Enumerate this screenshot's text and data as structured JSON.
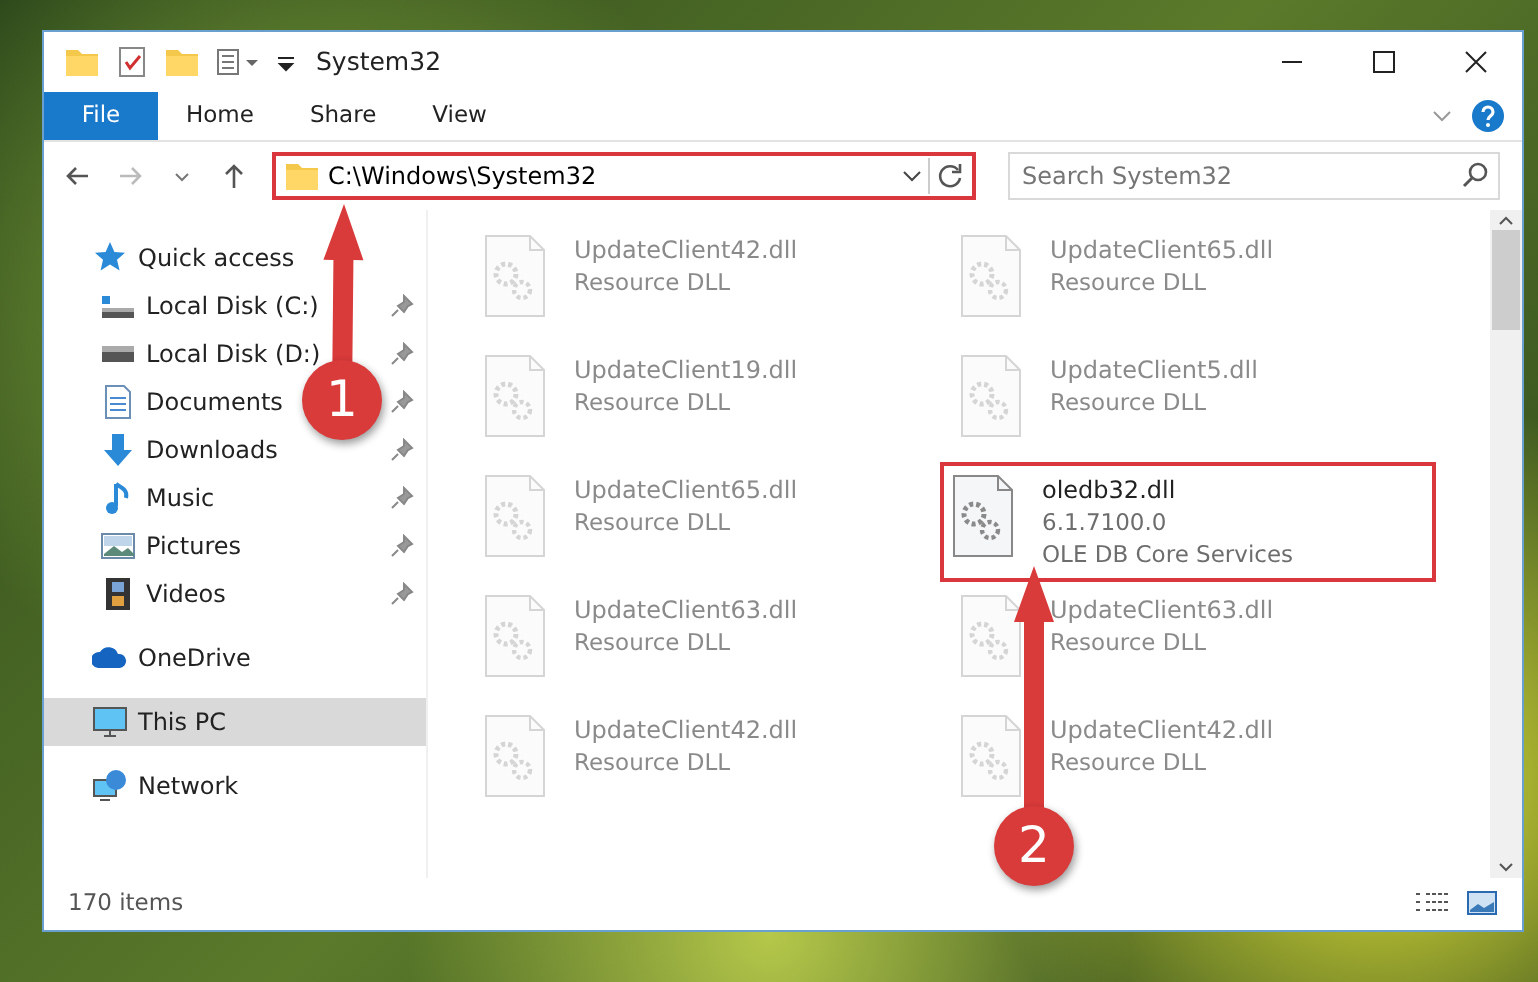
{
  "window": {
    "title": "System32"
  },
  "ribbon_tabs": [
    {
      "label": "File",
      "selected": true
    },
    {
      "label": "Home",
      "selected": false
    },
    {
      "label": "Share",
      "selected": false
    },
    {
      "label": "View",
      "selected": false
    }
  ],
  "address": {
    "path": "C:\\Windows\\System32",
    "highlighted": true
  },
  "search": {
    "placeholder": "Search System32"
  },
  "sidebar": {
    "items": [
      {
        "label": "Quick access",
        "kind": "star",
        "selected": false,
        "children": [
          {
            "label": "Local Disk (C:)",
            "kind": "disk-c",
            "pinned": true,
            "selected": false
          },
          {
            "label": "Local Disk (D:)",
            "kind": "disk",
            "pinned": true,
            "selected": false
          },
          {
            "label": "Documents",
            "kind": "documents",
            "pinned": true,
            "selected": false
          },
          {
            "label": "Downloads",
            "kind": "downloads",
            "pinned": true,
            "selected": false
          },
          {
            "label": "Music",
            "kind": "music",
            "pinned": true,
            "selected": false
          },
          {
            "label": "Pictures",
            "kind": "pictures",
            "pinned": true,
            "selected": false
          },
          {
            "label": "Videos",
            "kind": "videos",
            "pinned": true,
            "selected": false
          }
        ]
      },
      {
        "label": "OneDrive",
        "kind": "cloud",
        "selected": false
      },
      {
        "label": "This PC",
        "kind": "pc",
        "selected": true
      },
      {
        "label": "Network",
        "kind": "network",
        "selected": false
      }
    ]
  },
  "files": [
    {
      "name": "UpdateClient42.dll",
      "details": [
        "Resource DLL"
      ],
      "faded": true,
      "highlighted": false
    },
    {
      "name": "UpdateClient65.dll",
      "details": [
        "Resource DLL"
      ],
      "faded": true,
      "highlighted": false
    },
    {
      "name": "UpdateClient19.dll",
      "details": [
        "Resource DLL"
      ],
      "faded": true,
      "highlighted": false
    },
    {
      "name": "UpdateClient5.dll",
      "details": [
        "Resource DLL"
      ],
      "faded": true,
      "highlighted": false
    },
    {
      "name": "UpdateClient65.dll",
      "details": [
        "Resource DLL"
      ],
      "faded": true,
      "highlighted": false
    },
    {
      "name": "oledb32.dll",
      "details": [
        "6.1.7100.0",
        "OLE DB Core Services"
      ],
      "faded": false,
      "highlighted": true
    },
    {
      "name": "UpdateClient63.dll",
      "details": [
        "Resource DLL"
      ],
      "faded": true,
      "highlighted": false
    },
    {
      "name": "UpdateClient63.dll",
      "details": [
        "Resource DLL"
      ],
      "faded": true,
      "highlighted": false
    },
    {
      "name": "UpdateClient42.dll",
      "details": [
        "Resource DLL"
      ],
      "faded": true,
      "highlighted": false
    },
    {
      "name": "UpdateClient42.dll",
      "details": [
        "Resource DLL"
      ],
      "faded": true,
      "highlighted": false
    }
  ],
  "status_bar": {
    "text": "170 items"
  },
  "annotations": [
    {
      "number": "1"
    },
    {
      "number": "2"
    }
  ]
}
